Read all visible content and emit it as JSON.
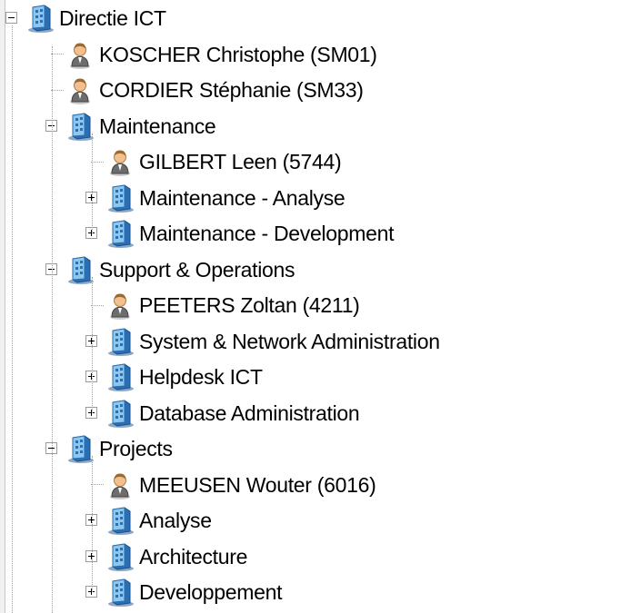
{
  "tree": {
    "nodes": [
      {
        "label": "Directie ICT",
        "type": "org",
        "level": 0,
        "state": "expanded"
      },
      {
        "label": "KOSCHER Christophe (SM01)",
        "type": "person",
        "level": 1,
        "state": "leaf"
      },
      {
        "label": "CORDIER Stéphanie (SM33)",
        "type": "person",
        "level": 1,
        "state": "leaf"
      },
      {
        "label": "Maintenance",
        "type": "org",
        "level": 1,
        "state": "expanded"
      },
      {
        "label": "GILBERT Leen (5744)",
        "type": "person",
        "level": 2,
        "state": "leaf"
      },
      {
        "label": "Maintenance - Analyse",
        "type": "org",
        "level": 2,
        "state": "collapsed"
      },
      {
        "label": "Maintenance - Development",
        "type": "org",
        "level": 2,
        "state": "collapsed"
      },
      {
        "label": "Support & Operations",
        "type": "org",
        "level": 1,
        "state": "expanded"
      },
      {
        "label": "PEETERS Zoltan (4211)",
        "type": "person",
        "level": 2,
        "state": "leaf"
      },
      {
        "label": "System & Network Administration",
        "type": "org",
        "level": 2,
        "state": "collapsed"
      },
      {
        "label": "Helpdesk ICT",
        "type": "org",
        "level": 2,
        "state": "collapsed"
      },
      {
        "label": "Database Administration",
        "type": "org",
        "level": 2,
        "state": "collapsed"
      },
      {
        "label": "Projects",
        "type": "org",
        "level": 1,
        "state": "expanded"
      },
      {
        "label": "MEEUSEN Wouter (6016)",
        "type": "person",
        "level": 2,
        "state": "leaf"
      },
      {
        "label": "Analyse",
        "type": "org",
        "level": 2,
        "state": "collapsed"
      },
      {
        "label": "Architecture",
        "type": "org",
        "level": 2,
        "state": "collapsed"
      },
      {
        "label": "Developpement",
        "type": "org",
        "level": 2,
        "state": "collapsed"
      }
    ],
    "icons": {
      "org": "building-icon",
      "person": "person-icon"
    },
    "colors": {
      "building_blue": "#2a6fb3",
      "building_light": "#8ec7ee",
      "person_skin": "#f2c08f",
      "person_suit": "#6d6d6d",
      "connector": "#a0a0a0"
    }
  }
}
